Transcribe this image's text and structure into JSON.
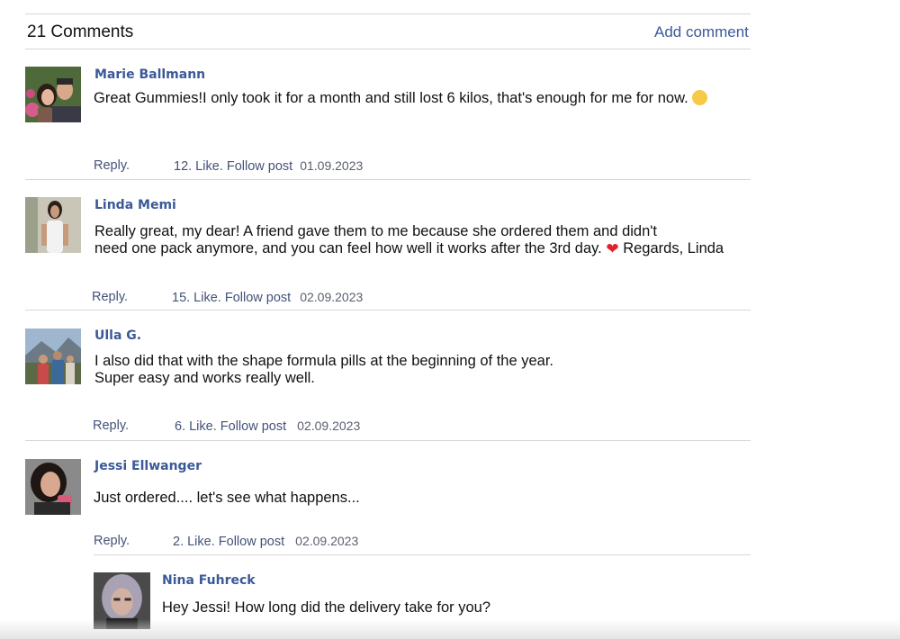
{
  "header": {
    "count_label": "21 Comments",
    "add_comment": "Add comment"
  },
  "comments": [
    {
      "author": "Marie Ballmann",
      "text_lines": [
        "Great Gummies!I only took it for a month and still lost 6 kilos, that's enough for me for now."
      ],
      "emoji": "laughing-face",
      "reply": "Reply.",
      "likes": "12. Like. Follow post",
      "date": "01.09.2023"
    },
    {
      "author": "Linda Memi",
      "text_lines": [
        "Really great, my dear! A friend gave them to me because she ordered them and didn't",
        "need one pack anymore, and you can feel how well it works after the 3rd day.",
        "Regards, Linda"
      ],
      "emoji": "red-heart",
      "reply": "Reply.",
      "likes": "15. Like. Follow post",
      "date": "02.09.2023"
    },
    {
      "author": "Ulla G.",
      "text_lines": [
        "I also did that with the shape formula pills at the beginning of the year.",
        "Super easy and works really well."
      ],
      "reply": "Reply.",
      "likes": "6. Like. Follow post",
      "date": "02.09.2023"
    },
    {
      "author": "Jessi Ellwanger",
      "text_lines": [
        "Just ordered.... let's see what happens..."
      ],
      "reply": "Reply.",
      "likes": "2. Like. Follow post",
      "date": "02.09.2023"
    }
  ],
  "reply_comment": {
    "author": "Nina Fuhreck",
    "text": "Hey Jessi! How long did the delivery take for you?"
  },
  "colors": {
    "link": "#3b5998",
    "meta": "#44527a",
    "divider": "#d7d7d7"
  }
}
